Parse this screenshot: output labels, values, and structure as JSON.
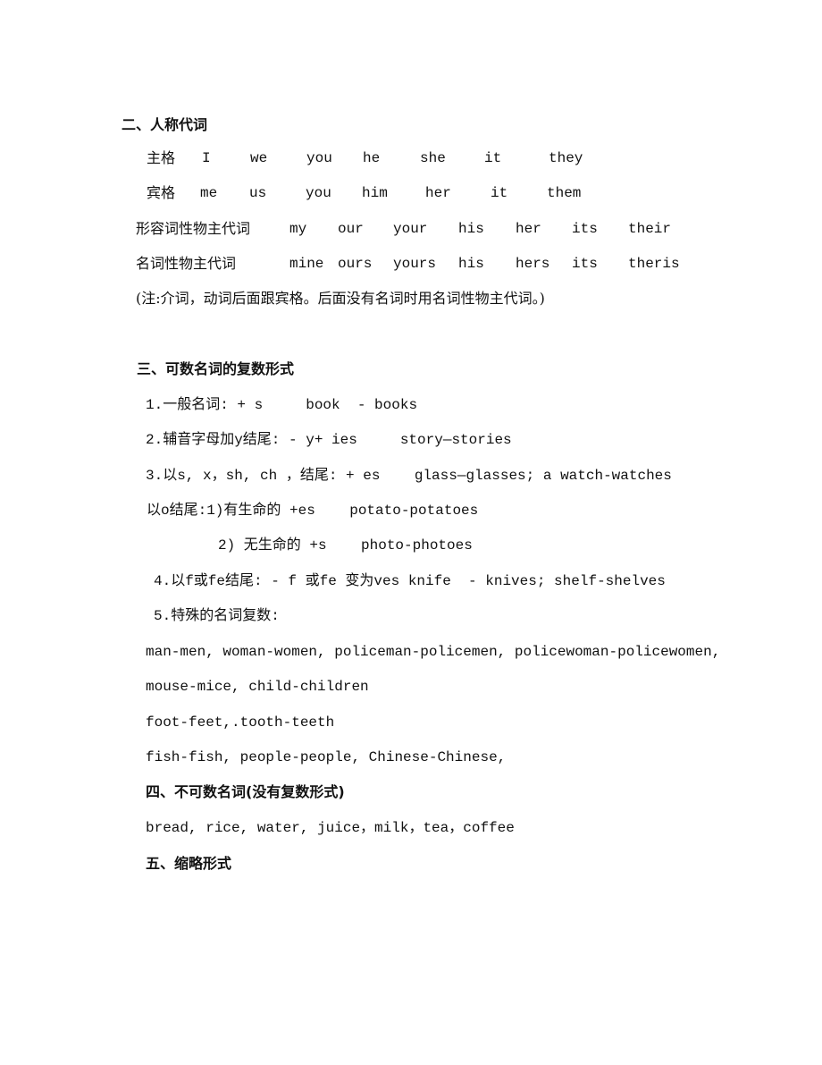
{
  "section2": {
    "heading": "二、人称代词",
    "rows": [
      {
        "label": "主格",
        "cells": [
          "I",
          "we",
          "you",
          "he",
          "she",
          "it",
          "they"
        ]
      },
      {
        "label": "宾格",
        "cells": [
          "me",
          "us",
          "you",
          "him",
          "her",
          "it",
          "them"
        ]
      },
      {
        "label": "形容词性物主代词",
        "cells": [
          "my",
          "our",
          "your",
          "his",
          "her",
          "its",
          "their"
        ]
      },
      {
        "label": "名词性物主代词",
        "cells": [
          "mine",
          "ours",
          "yours",
          "his",
          "hers",
          "its",
          "theris"
        ]
      }
    ],
    "note": "(注:介词，动词后面跟宾格。后面没有名词时用名词性物主代词。)"
  },
  "section3": {
    "heading": "三、可数名词的复数形式",
    "lines": [
      "1.一般名词: + s     book  - books",
      "2.辅音字母加y结尾: - y+ ies     story—stories",
      "3.以s, x，sh, ch ，结尾: + es    glass—glasses; a watch-watches",
      "以o结尾:1)有生命的 +es    potato-potatoes",
      "2) 无生命的 +s    photo-photoes",
      "4.以f或fe结尾: - f 或fe 变为ves knife  - knives; shelf-shelves",
      "5.特殊的名词复数:",
      "man-men, woman-women, policeman-policemen, policewoman-policewomen,",
      "mouse-mice, child-children",
      "foot-feet,.tooth-teeth",
      "fish-fish, people-people, Chinese-Chinese,"
    ]
  },
  "section4": {
    "heading": "四、不可数名词(没有复数形式)",
    "line": "bread, rice, water, juice，milk，tea，coffee"
  },
  "section5": {
    "heading": "五、缩略形式"
  }
}
